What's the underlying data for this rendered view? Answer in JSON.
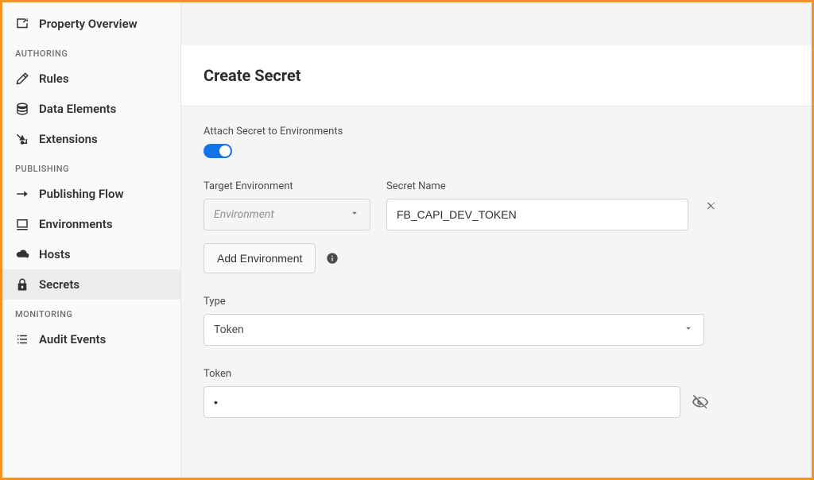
{
  "sidebar": {
    "top": {
      "label": "Property Overview"
    },
    "sections": {
      "authoring": {
        "heading": "AUTHORING",
        "items": [
          {
            "label": "Rules"
          },
          {
            "label": "Data Elements"
          },
          {
            "label": "Extensions"
          }
        ]
      },
      "publishing": {
        "heading": "PUBLISHING",
        "items": [
          {
            "label": "Publishing Flow"
          },
          {
            "label": "Environments"
          },
          {
            "label": "Hosts"
          },
          {
            "label": "Secrets"
          }
        ]
      },
      "monitoring": {
        "heading": "MONITORING",
        "items": [
          {
            "label": "Audit Events"
          }
        ]
      }
    }
  },
  "page": {
    "title": "Create Secret"
  },
  "form": {
    "attach_label": "Attach Secret to Environments",
    "attach_toggle_on": true,
    "target_env_label": "Target Environment",
    "target_env_placeholder": "Environment",
    "secret_name_label": "Secret Name",
    "secret_name_value": "FB_CAPI_DEV_TOKEN",
    "add_environment_label": "Add Environment",
    "type_label": "Type",
    "type_value": "Token",
    "token_label": "Token",
    "token_value": "•"
  }
}
